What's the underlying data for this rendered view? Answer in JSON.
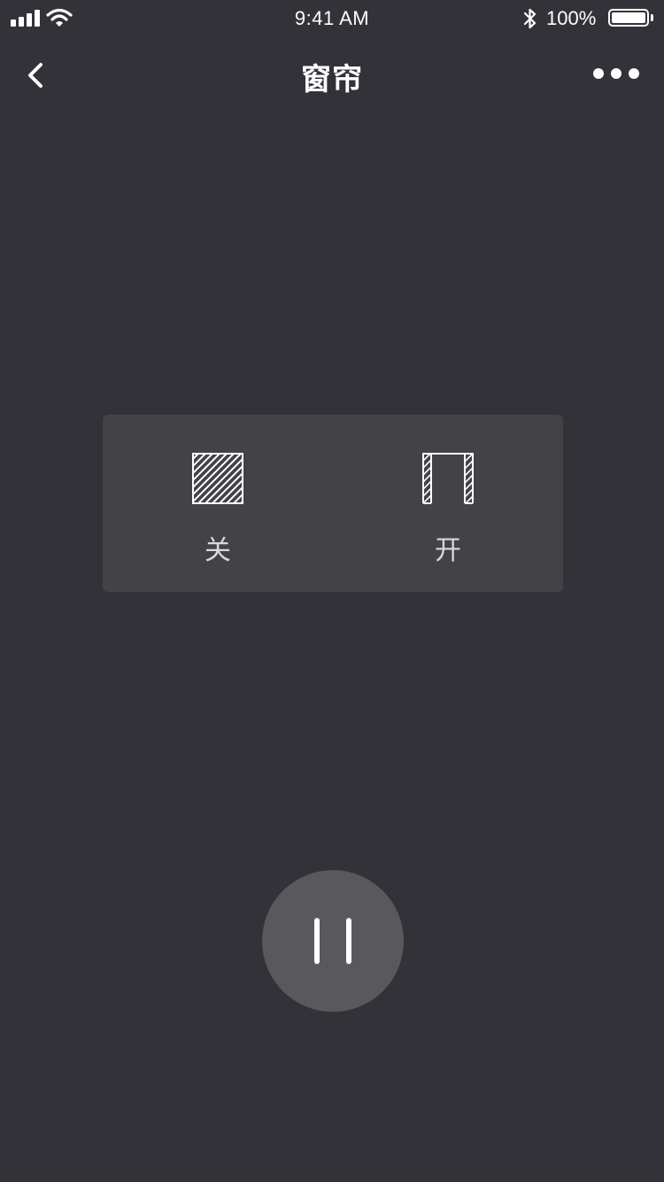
{
  "status_bar": {
    "time": "9:41 AM",
    "battery_percent": "100%",
    "battery_level": 1.0,
    "signal_icon": "signal-icon",
    "wifi_icon": "wifi-icon",
    "bluetooth_icon": "bluetooth-icon"
  },
  "nav": {
    "title": "窗帘",
    "back_icon": "chevron-left-icon",
    "more_icon": "more-dots-icon"
  },
  "controls": {
    "close": {
      "label": "关",
      "icon": "curtain-closed-icon"
    },
    "open": {
      "label": "开",
      "icon": "curtain-open-icon"
    }
  },
  "pause": {
    "icon": "pause-icon"
  },
  "colors": {
    "background": "#333238",
    "panel": "#434247",
    "pause_button": "#59595d",
    "label": "#d9d9dc",
    "foreground": "#ffffff"
  }
}
